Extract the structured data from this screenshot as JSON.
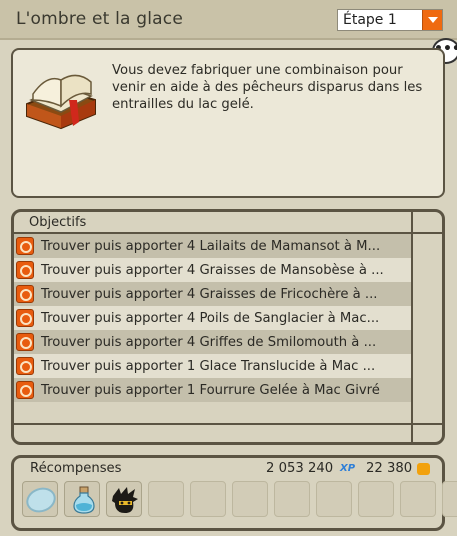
{
  "header": {
    "title": "L'ombre et la glace",
    "step_select": {
      "value": "Étape 1"
    }
  },
  "chat_bubble": "•••",
  "description": {
    "text": "Vous devez fabriquer une combinaison pour venir en aide à des pêcheurs disparus dans les entrailles du lac gelé."
  },
  "objectives": {
    "header": "Objectifs",
    "items": [
      {
        "label": "Trouver puis apporter 4 Lailaits de Mamansot à M..."
      },
      {
        "label": "Trouver puis apporter 4 Graisses de Mansobèse à ..."
      },
      {
        "label": "Trouver puis apporter 4 Graisses de Fricochère à ..."
      },
      {
        "label": "Trouver puis apporter 4 Poils de Sanglacier à Mac..."
      },
      {
        "label": "Trouver puis apporter 4 Griffes de Smilomouth à ..."
      },
      {
        "label": "Trouver puis apporter 1 Glace Translucide à Mac ..."
      },
      {
        "label": "Trouver puis apporter 1 Fourrure Gelée à Mac Givré"
      }
    ]
  },
  "rewards": {
    "label": "Récompenses",
    "xp": "2 053 240",
    "xp_badge": "XP",
    "kamas": "22 380",
    "items": [
      {
        "icon": "ice-disc-icon"
      },
      {
        "icon": "potion-icon"
      },
      {
        "icon": "black-mask-icon"
      }
    ],
    "empty_slots": 8
  },
  "colors": {
    "accent": "#ef6a10",
    "panel_bg": "#d8d3bf",
    "frame": "#5b5443"
  }
}
